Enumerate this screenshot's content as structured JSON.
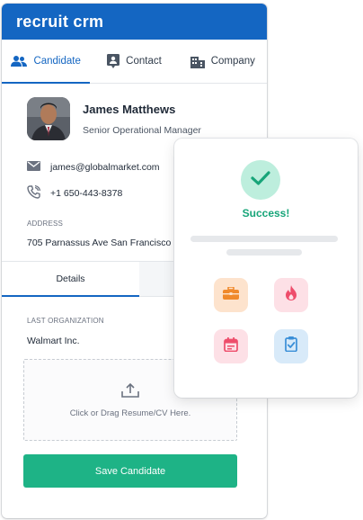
{
  "app": {
    "title": "recruit crm"
  },
  "tabs": [
    {
      "label": "Candidate",
      "icon": "people-icon",
      "active": true
    },
    {
      "label": "Contact",
      "icon": "contact-card-icon",
      "active": false
    },
    {
      "label": "Company",
      "icon": "building-icon",
      "active": false
    }
  ],
  "profile": {
    "name": "James Matthews",
    "role": "Senior Operational Manager",
    "email": "james@globalmarket.com",
    "phone": "+1 650-443-8378",
    "address_label": "ADDRESS",
    "address": "705 Parnassus Ave San Francisco"
  },
  "subtabs": [
    {
      "label": "Details",
      "active": true
    },
    {
      "label": "",
      "active": false
    }
  ],
  "details": {
    "org_label": "LAST ORGANIZATION",
    "org_value": "Walmart Inc.",
    "upload_text": "Click or Drag Resume/CV Here.",
    "save_label": "Save Candidate"
  },
  "popup": {
    "success_text": "Success!",
    "icons": [
      {
        "name": "briefcase-icon",
        "bg": "#fde3cd",
        "fg": "#f08a2c"
      },
      {
        "name": "fire-icon",
        "bg": "#fde0e6",
        "fg": "#ee4d6b"
      },
      {
        "name": "calendar-icon",
        "bg": "#fde0e6",
        "fg": "#ee4d6b"
      },
      {
        "name": "clipboard-check-icon",
        "bg": "#d8eaf9",
        "fg": "#3a8fd8"
      }
    ]
  },
  "colors": {
    "brand": "#1466c2",
    "success": "#1eb386",
    "success_text": "#17a579"
  }
}
